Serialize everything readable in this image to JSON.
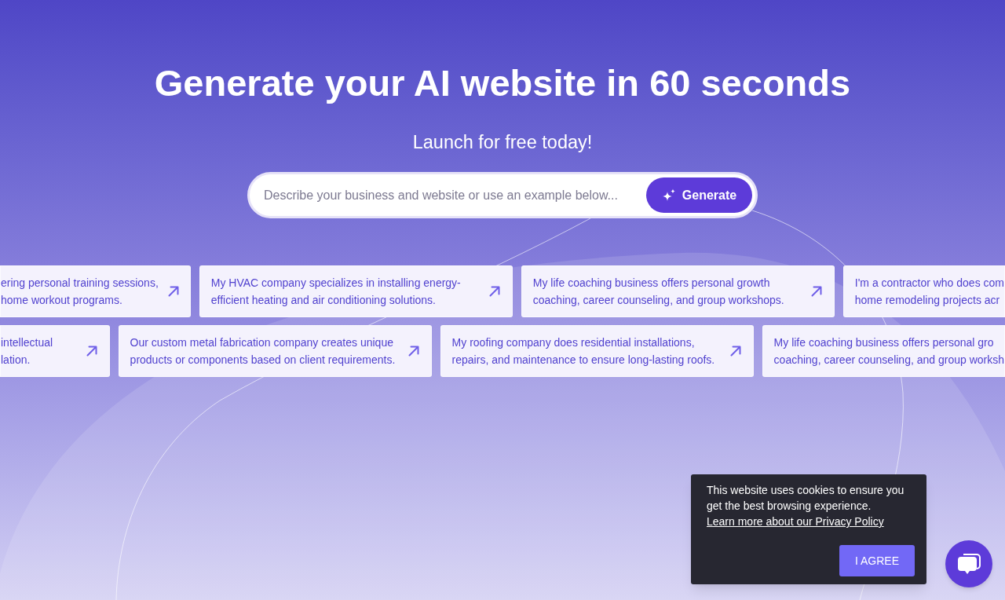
{
  "hero": {
    "title": "Generate your AI website in 60 seconds",
    "subtitle": "Launch for free today!"
  },
  "prompt": {
    "placeholder": "Describe your business and website or use an example below...",
    "button": "Generate"
  },
  "example_rows": [
    {
      "cards": [
        {
          "kind": "cut_start",
          "lines": [
            "ering personal training sessions,",
            "home workout programs."
          ]
        },
        {
          "kind": "full",
          "lines": [
            "My HVAC company specializes in installing energy-",
            "efficient heating and air conditioning solutions."
          ]
        },
        {
          "kind": "full",
          "lines": [
            "My life coaching business offers personal growth",
            "coaching, career counseling, and group workshops."
          ]
        },
        {
          "kind": "cut_end",
          "lines": [
            "I'm a contractor who does com",
            "home remodeling projects acr"
          ]
        }
      ]
    },
    {
      "cards": [
        {
          "kind": "cut_start",
          "lines": [
            "intellectual",
            "lation."
          ]
        },
        {
          "kind": "full",
          "lines": [
            "Our custom metal fabrication company creates unique",
            "products or components based on client requirements."
          ]
        },
        {
          "kind": "full",
          "lines": [
            "My roofing company does residential installations,",
            "repairs, and maintenance to ensure long-lasting roofs."
          ]
        },
        {
          "kind": "cut_end",
          "lines": [
            "My life coaching business offers personal gro",
            "coaching, career counseling, and group worksh"
          ]
        }
      ]
    }
  ],
  "cookie_banner": {
    "message": "This website uses cookies to ensure you get the best browsing experience.",
    "link": "Learn more about our Privacy Policy",
    "button": "I AGREE"
  }
}
